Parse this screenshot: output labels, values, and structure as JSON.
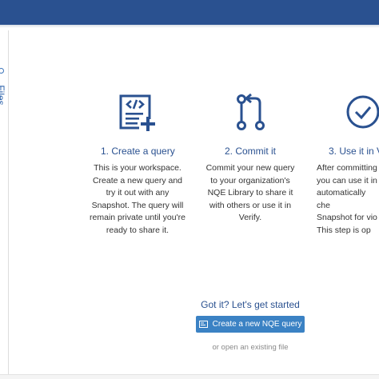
{
  "side_panel": {
    "tab_label": "Files"
  },
  "steps": [
    {
      "title": "1. Create a query",
      "text": "This is your workspace.\nCreate a new query and\ntry it out with any\nSnapshot. The query will\nremain private until you're\nready to share it.",
      "icon": "create-query-icon"
    },
    {
      "title": "2. Commit it",
      "text": "Commit your new query\nto your organization's\nNQE Library to share it\nwith others or use it in\nVerify.",
      "icon": "commit-icon"
    },
    {
      "title": "3. Use it in V",
      "text": "After committing\nyou can use it in\nautomatically che\nSnapshot for vio\nThis step is op",
      "icon": "check-circle-icon"
    }
  ],
  "cta": {
    "title": "Got it? Let's get started",
    "button_label": "Create a new NQE query",
    "open_link": "or open an existing file"
  },
  "colors": {
    "topbar": "#2a5190",
    "accent": "#2a5190",
    "button": "#3b82c4"
  }
}
